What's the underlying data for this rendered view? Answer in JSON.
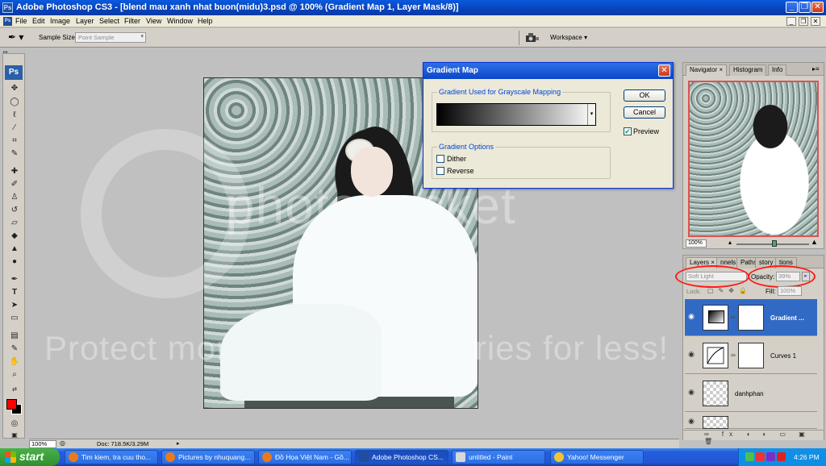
{
  "window": {
    "title": "Adobe Photoshop CS3 - [blend mau xanh nhat buon(midu)3.psd @ 100% (Gradient Map 1, Layer Mask/8)]",
    "logo": "Ps",
    "controls": {
      "minimize": "_",
      "restore": "❐",
      "close": "✕"
    }
  },
  "menu": {
    "logo": "Ps",
    "items": [
      "File",
      "Edit",
      "Image",
      "Layer",
      "Select",
      "Filter",
      "View",
      "Window",
      "Help"
    ],
    "doc_controls": {
      "minimize": "_",
      "restore": "❐",
      "close": "✕"
    }
  },
  "options_bar": {
    "sample_size_label": "Sample Size:",
    "sample_size_value": "Point Sample",
    "workspace_label": "Workspace ▾"
  },
  "toolbox": {
    "logo": "Ps",
    "foreground_color": "#ff0000",
    "background_color": "#000000",
    "tools": [
      "move-icon",
      "marquee-icon",
      "lasso-icon",
      "quick-select-icon",
      "crop-icon",
      "eyedropper-icon",
      "healing-brush-icon",
      "brush-icon",
      "clone-stamp-icon",
      "history-brush-icon",
      "eraser-icon",
      "paint-bucket-icon",
      "blur-icon",
      "dodge-icon",
      "pen-icon",
      "type-icon",
      "path-select-icon",
      "shape-icon",
      "notes-icon",
      "eyedropper2-icon",
      "hand-icon",
      "zoom-icon"
    ]
  },
  "watermark": {
    "line1": "photobucket",
    "line2": "Protect more of your memories for less!"
  },
  "gradient_dialog": {
    "title": "Gradient Map",
    "mapping_legend": "Gradient Used for Grayscale Mapping",
    "options_legend": "Gradient Options",
    "dither_label": "Dither",
    "reverse_label": "Reverse",
    "dither_checked": false,
    "reverse_checked": false,
    "ok_label": "OK",
    "cancel_label": "Cancel",
    "preview_label": "Preview",
    "preview_checked": true
  },
  "navigator_panel": {
    "tabs": [
      "Navigator ×",
      "Histogram",
      "Info"
    ],
    "zoom": "100%"
  },
  "layers_panel": {
    "tabs": [
      "Layers ×",
      "nnels",
      "Paths",
      "story",
      "tions"
    ],
    "blend_mode": "Soft Light",
    "opacity_label": "Opacity:",
    "opacity_value": "39%",
    "lock_label": "Lock:",
    "fill_label": "Fill:",
    "fill_value": "100%",
    "layers": [
      {
        "name": "Gradient ...",
        "selected": true
      },
      {
        "name": "Curves 1",
        "selected": false
      },
      {
        "name": "danhphan",
        "selected": false
      }
    ],
    "footer_icons": "∞ fx ◑ ◐ ▭ ▣ 🗑"
  },
  "status_bar": {
    "zoom": "100%",
    "doc_info": "Doc: 718.5K/3.29M"
  },
  "taskbar": {
    "start_label": "start",
    "tasks": [
      {
        "label": "Tim kiem, tra cuu tho...",
        "active": false
      },
      {
        "label": "Pictures by nhuquang...",
        "active": false
      },
      {
        "label": "Đồ Họa Việt Nam - Gồ...",
        "active": false
      },
      {
        "label": "Adobe Photoshop CS...",
        "active": true
      },
      {
        "label": "untitled - Paint",
        "active": false
      },
      {
        "label": "Yahoo! Messenger",
        "active": false
      }
    ],
    "clock": "4:26 PM"
  }
}
